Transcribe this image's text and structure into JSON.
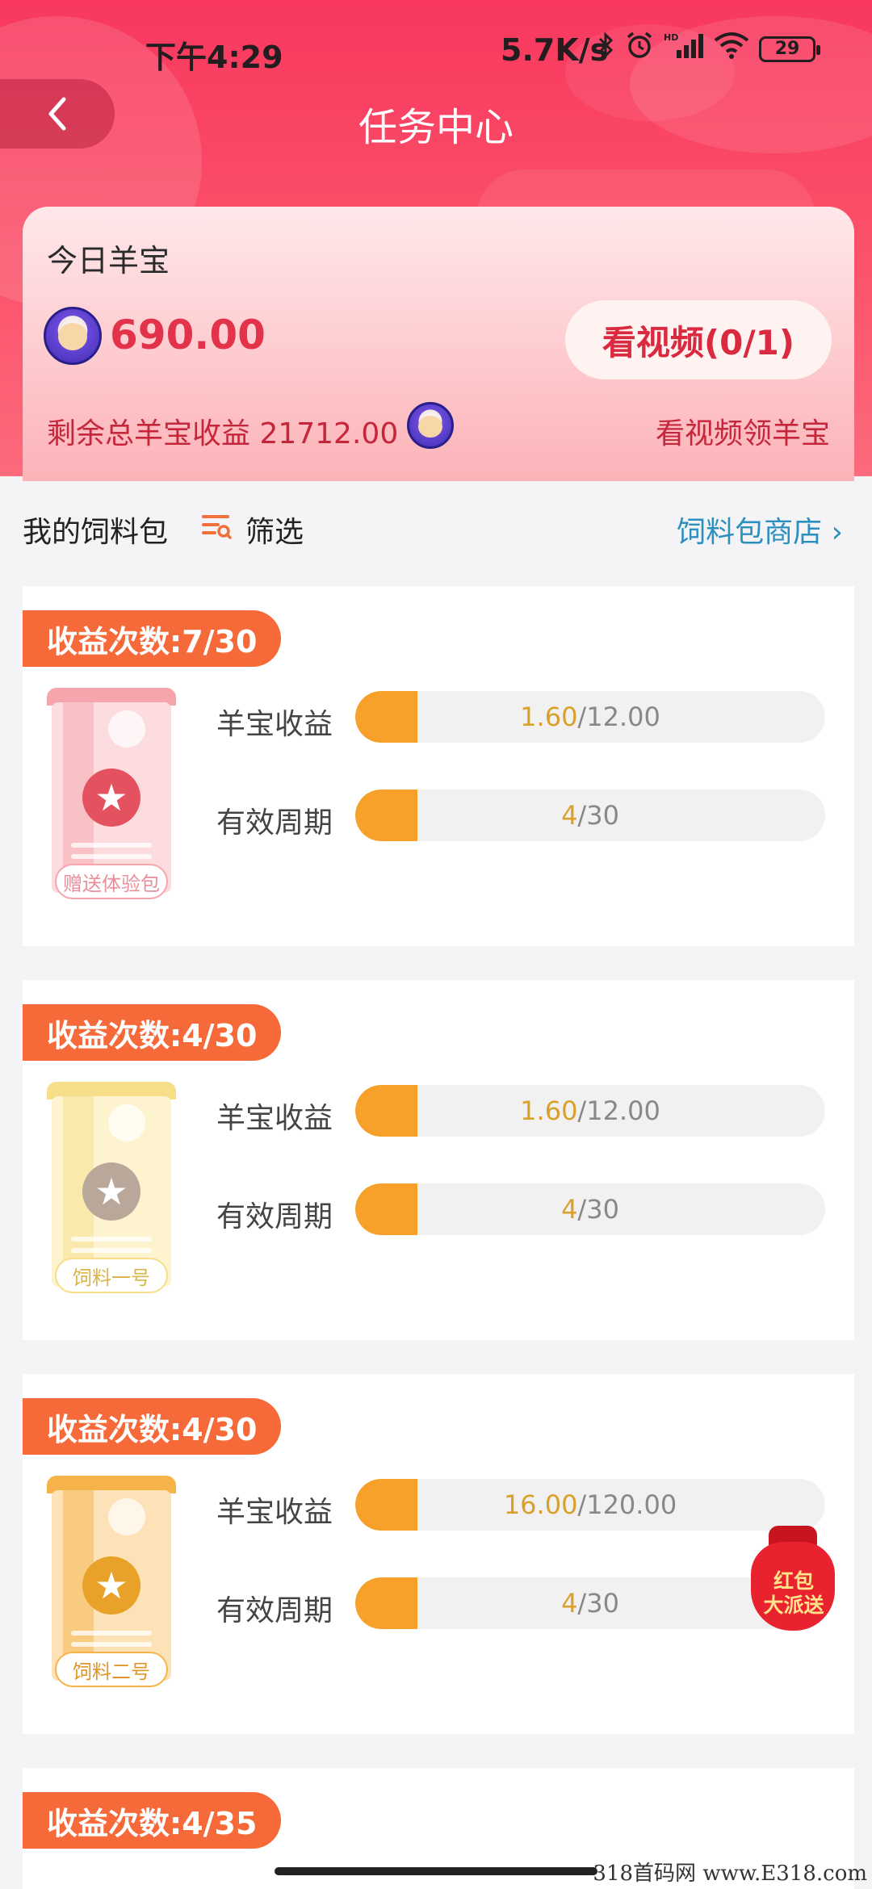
{
  "status_bar": {
    "time": "下午4:29",
    "network_speed": "5.7K/s",
    "icons": [
      "bluetooth-icon",
      "alarm-icon",
      "hd-signal-icon",
      "wifi-icon",
      "battery-icon"
    ],
    "battery_level": "29"
  },
  "header": {
    "title": "任务中心",
    "back_icon": "chevron-left-icon"
  },
  "summary": {
    "today_label": "今日羊宝",
    "today_amount": "690.00",
    "video_button": "看视频(0/1)",
    "remaining_label": "剩余总羊宝收益 21712.00",
    "watch_link": "看视频领羊宝"
  },
  "section": {
    "title": "我的饲料包",
    "filter_label": "筛选",
    "shop_link": "饲料包商店",
    "shop_chevron": "›"
  },
  "feed_packs": [
    {
      "count_label": "收益次数:7/30",
      "bag_label": "赠送体验包",
      "bag_color": "#f6a5ad",
      "metrics": [
        {
          "label": "羊宝收益",
          "current": "1.60",
          "total": "/12.00",
          "fraction": 0.133
        },
        {
          "label": "有效周期",
          "current": "4",
          "total": "/30",
          "fraction": 0.133
        }
      ]
    },
    {
      "count_label": "收益次数:4/30",
      "bag_label": "饲料一号",
      "bag_color": "#f7df8a",
      "metrics": [
        {
          "label": "羊宝收益",
          "current": "1.60",
          "total": "/12.00",
          "fraction": 0.133
        },
        {
          "label": "有效周期",
          "current": "4",
          "total": "/30",
          "fraction": 0.133
        }
      ]
    },
    {
      "count_label": "收益次数:4/30",
      "bag_label": "饲料二号",
      "bag_color": "#f6b34a",
      "metrics": [
        {
          "label": "羊宝收益",
          "current": "16.00",
          "total": "/120.00",
          "fraction": 0.133
        },
        {
          "label": "有效周期",
          "current": "4",
          "total": "/30",
          "fraction": 0.133
        }
      ]
    },
    {
      "count_label": "收益次数:4/35"
    }
  ],
  "floating_badge": {
    "line1": "红包",
    "line2": "大派送"
  },
  "watermark": "318首码网 www.E318.com",
  "colors": {
    "header_red": "#f8385f",
    "amount_red": "#e3334a",
    "badge_orange": "#f66a3a",
    "progress_orange": "#f7a12a",
    "link_blue": "#2b8fbf"
  }
}
